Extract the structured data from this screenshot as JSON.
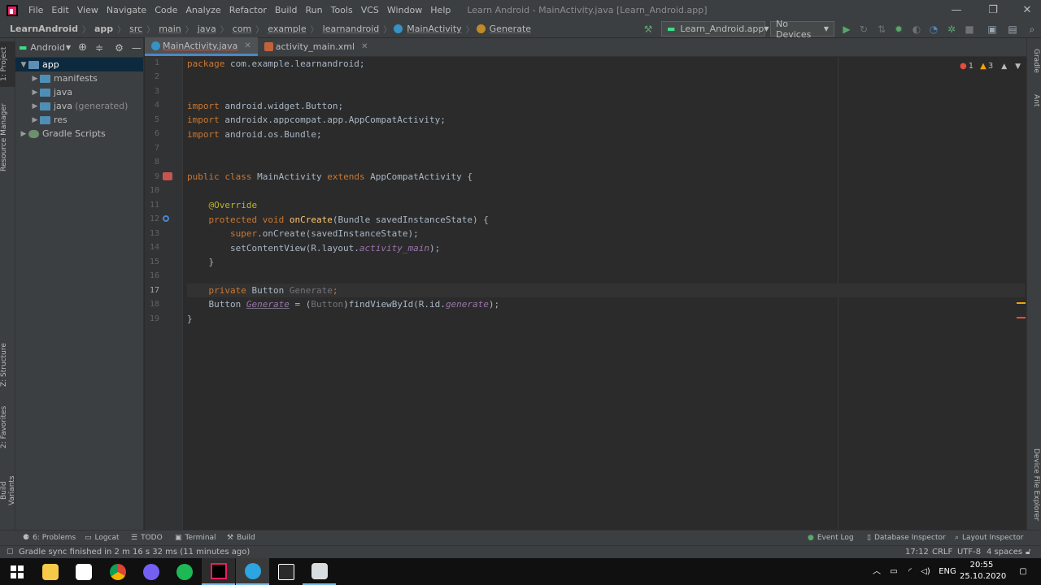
{
  "menubar": {
    "items": [
      "File",
      "Edit",
      "View",
      "Navigate",
      "Code",
      "Analyze",
      "Refactor",
      "Build",
      "Run",
      "Tools",
      "VCS",
      "Window",
      "Help"
    ],
    "title": "Learn Android - MainActivity.java [Learn_Android.app]",
    "controls": {
      "minimize": "—",
      "maximize": "❐",
      "close": "✕"
    }
  },
  "breadcrumb": [
    "LearnAndroid",
    "app",
    "src",
    "main",
    "java",
    "com",
    "example",
    "learnandroid",
    "MainActivity",
    "Generate"
  ],
  "toolbar": {
    "run_config": "Learn_Android.app",
    "device": "No Devices"
  },
  "left_tabs": {
    "project": "1: Project",
    "resource": "Resource Manager",
    "structure": "Z: Structure",
    "favorites": "2: Favorites",
    "build_variants": "Build Variants"
  },
  "right_tabs": {
    "gradle": "Gradle",
    "ant": "Ant",
    "device_explorer": "Device File Explorer"
  },
  "project_panel": {
    "view": "Android",
    "tree": [
      {
        "label": "app",
        "level": 0
      },
      {
        "label": "manifests",
        "level": 1
      },
      {
        "label": "java",
        "level": 1
      },
      {
        "label": "java",
        "suffix": "(generated)",
        "level": 1
      },
      {
        "label": "res",
        "level": 1
      },
      {
        "label": "Gradle Scripts",
        "level": 0
      }
    ]
  },
  "editor": {
    "tabs": [
      {
        "label": "MainActivity.java",
        "active": true
      },
      {
        "label": "activity_main.xml",
        "active": false
      }
    ],
    "inspection": {
      "errors": "1",
      "warnings": "3"
    },
    "line_numbers": [
      "1",
      "2",
      "3",
      "4",
      "5",
      "6",
      "7",
      "8",
      "9",
      "10",
      "11",
      "12",
      "13",
      "14",
      "15",
      "16",
      "17",
      "18",
      "19"
    ],
    "code": {
      "l1_kw": "package",
      "l1_rest": " com.example.learnandroid;",
      "l4_kw": "import",
      "l4_rest": " android.widget.Button;",
      "l5_kw": "import",
      "l5_rest": " androidx.appcompat.app.AppCompatActivity;",
      "l6_kw": "import",
      "l6_rest": " android.os.Bundle;",
      "l9_kw1": "public class",
      "l9_name": " MainActivity ",
      "l9_kw2": "extends",
      "l9_rest": " AppCompatActivity {",
      "l11_ann": "    @Override",
      "l12_kw": "    protected void ",
      "l12_fn": "onCreate",
      "l12_rest": "(Bundle savedInstanceState) {",
      "l13_kw": "        super",
      "l13_rest": ".onCreate(savedInstanceState);",
      "l14_pre": "        setContentView(R.layout.",
      "l14_it": "activity_main",
      "l14_post": ");",
      "l15": "    }",
      "l17_kw": "    private ",
      "l17_type": "Button ",
      "l17_dim": "Generate",
      "l17_end": ";",
      "l18_pre": "    Button ",
      "l18_var": "Generate",
      "l18_mid": " = (",
      "l18_cast": "Button",
      "l18_call": ")findViewById(R.id.",
      "l18_it": "generate",
      "l18_end": ");",
      "l19": "}"
    }
  },
  "bottom_tools": {
    "problems": "6: Problems",
    "logcat": "Logcat",
    "todo": "TODO",
    "terminal": "Terminal",
    "build": "Build",
    "event_log": "Event Log",
    "db_inspector": "Database Inspector",
    "layout_inspector": "Layout Inspector"
  },
  "status": {
    "message": "Gradle sync finished in 2 m 16 s 32 ms (11 minutes ago)",
    "position": "17:12",
    "line_sep": "CRLF",
    "encoding": "UTF-8",
    "indent": "4 spaces"
  },
  "taskbar": {
    "lang": "ENG",
    "time": "20:55",
    "date": "25.10.2020"
  },
  "colors": {
    "keyword": "#cc7832",
    "annotation": "#bbb529",
    "function": "#ffc66d",
    "italic": "#9876aa",
    "text": "#a9b7c6",
    "error": "#e74c3c",
    "warning": "#f0a30a",
    "android_green": "#3ddc84"
  }
}
